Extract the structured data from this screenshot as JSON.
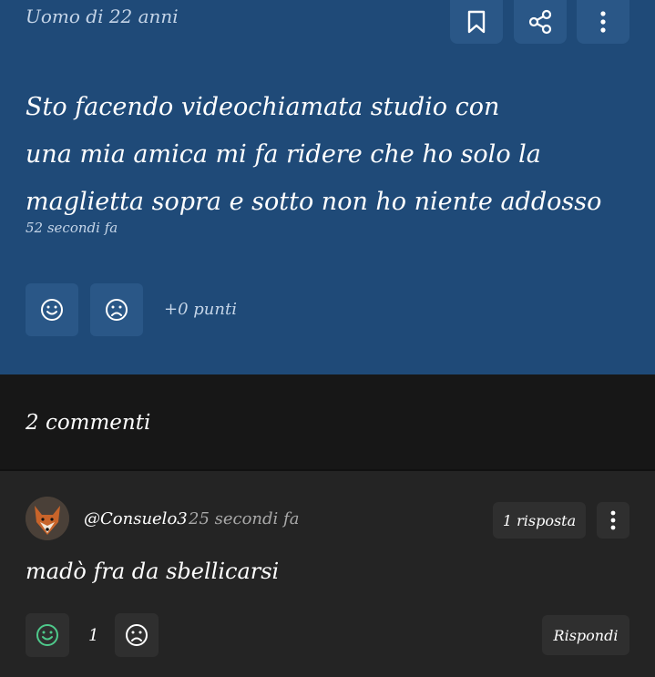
{
  "post": {
    "author": "Uomo di 22 anni",
    "text_lines": [
      "Sto facendo videochiamata studio con",
      "una mia amica mi fa ridere che ho solo la",
      "maglietta sopra e sotto non ho niente addosso"
    ],
    "time": "52 secondi fa",
    "points": "+0 punti",
    "icons": {
      "bookmark": "bookmark-icon",
      "share": "share-icon",
      "more": "more-vertical-icon",
      "like": "smile-icon",
      "dislike": "frown-icon"
    }
  },
  "comments": {
    "title": "2 commenti",
    "items": [
      {
        "username": "@Consuelo3",
        "time": "25 secondi fa",
        "replies": "1 risposta",
        "text": "madò fra da sbellicarsi",
        "score": "1",
        "reply_label": "Rispondi"
      }
    ]
  },
  "colors": {
    "post_bg": "#1f4a78",
    "post_button_bg": "#2a5787",
    "page_bg": "#242424",
    "header_bg": "#171717",
    "like_active": "#4ec98b"
  }
}
